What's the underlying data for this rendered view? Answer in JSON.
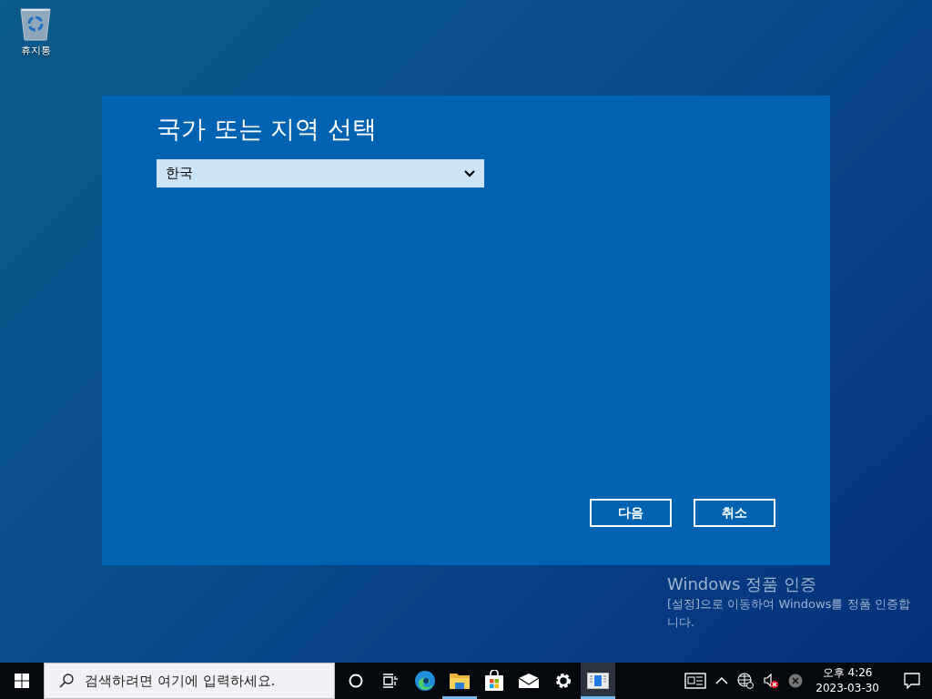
{
  "desktop_icons": [
    {
      "label": "휴지통"
    }
  ],
  "dialog": {
    "title": "국가 또는 지역 선택",
    "dropdown": {
      "value": "한국"
    },
    "buttons": [
      {
        "label": "다음"
      },
      {
        "label": "취소"
      }
    ]
  },
  "watermark": {
    "title": "Windows 정품 인증",
    "message": "[설정]으로 이동하여 Windows를 정품 인증합니다."
  },
  "taskbar": {
    "search": {
      "placeholder": "검색하려면 여기에 입력하세요."
    },
    "apps": [
      {
        "kind": "cortana",
        "running": false,
        "active": false
      },
      {
        "kind": "taskview",
        "running": false,
        "active": false
      },
      {
        "kind": "edge",
        "running": false,
        "active": false
      },
      {
        "kind": "explorer",
        "running": true,
        "active": false
      },
      {
        "kind": "store",
        "running": false,
        "active": false
      },
      {
        "kind": "mail",
        "running": false,
        "active": false
      },
      {
        "kind": "settings",
        "running": false,
        "active": false
      },
      {
        "kind": "setup",
        "running": true,
        "active": true
      }
    ],
    "clock": {
      "time": "오후 4:26",
      "date": "2023-03-30"
    }
  }
}
